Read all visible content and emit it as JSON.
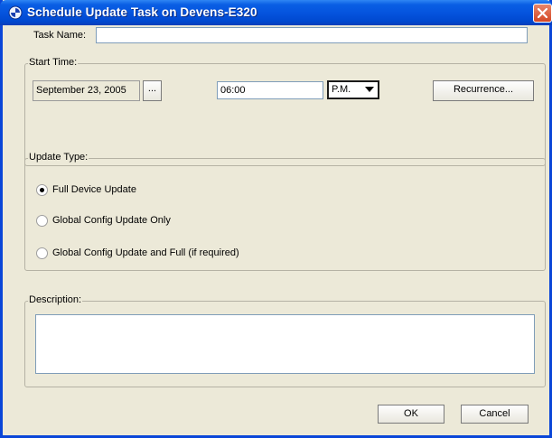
{
  "window": {
    "title": "Schedule Update Task on Devens-E320"
  },
  "task_name": {
    "label": "Task Name:",
    "value": ""
  },
  "start_time": {
    "group_label": "Start Time:",
    "date": "September 23, 2005",
    "date_picker_label": "...",
    "time": "06:00",
    "ampm": "P.M.",
    "recurrence_label": "Recurrence..."
  },
  "update_type": {
    "group_label": "Update Type:",
    "options": [
      {
        "label": "Full Device Update",
        "checked": true
      },
      {
        "label": "Global Config Update Only",
        "checked": false
      },
      {
        "label": "Global Config Update and Full (if required)",
        "checked": false
      }
    ]
  },
  "description": {
    "group_label": "Description:",
    "value": ""
  },
  "buttons": {
    "ok": "OK",
    "cancel": "Cancel"
  },
  "icons": {
    "title": "java-cup-icon",
    "close": "close-icon",
    "dropdown": "triangle-down-icon"
  }
}
